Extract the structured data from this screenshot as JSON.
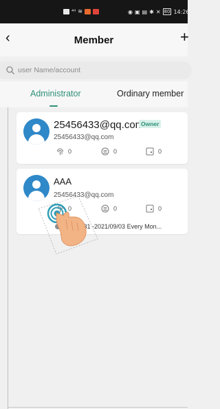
{
  "status_bar": {
    "time": "14:26",
    "battery": "80"
  },
  "header": {
    "title": "Member",
    "back_icon": "chevron-left-icon",
    "add_icon": "plus-icon"
  },
  "search": {
    "placeholder": "user Name/account"
  },
  "tabs": [
    {
      "label": "Administrator",
      "active": true
    },
    {
      "label": "Ordinary member",
      "active": false
    }
  ],
  "members": [
    {
      "name": "25456433@qq.com",
      "badge": "Owner",
      "email": "25456433@qq.com",
      "fingerprint_count": "0",
      "password_count": "0",
      "card_count": "0"
    },
    {
      "name": "AAA",
      "email": "25456433@qq.com",
      "fingerprint_count": "0",
      "password_count": "0",
      "card_count": "0",
      "schedule": "12/31 -2021/09/03 Every Mon..."
    }
  ],
  "colors": {
    "accent": "#2f8f79",
    "avatar": "#2f88c8",
    "badge_bg": "#d9f1ea"
  }
}
